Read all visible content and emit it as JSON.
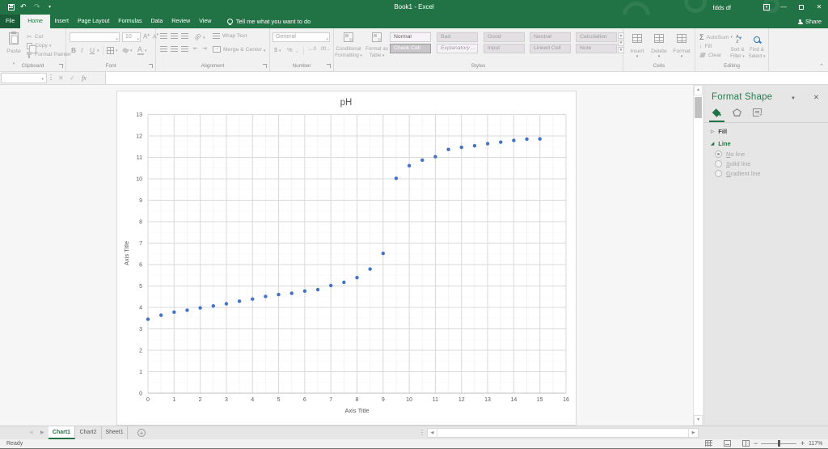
{
  "titlebar": {
    "title": "Book1 - Excel",
    "user": "fdds df"
  },
  "nav": {
    "file": "File",
    "tabs": [
      "Home",
      "Insert",
      "Page Layout",
      "Formulas",
      "Data",
      "Review",
      "View"
    ],
    "active_tab": "Home",
    "tell_me": "Tell me what you want to do",
    "share": "Share"
  },
  "ribbon": {
    "clipboard": {
      "label": "Clipboard",
      "paste": "Paste",
      "cut": "Cut",
      "copy": "Copy",
      "painter": "Format Painter"
    },
    "font": {
      "label": "Font",
      "size": "10",
      "bold": "B",
      "italic": "I",
      "underline": "U",
      "grow": "A",
      "shrink": "A",
      "color_letter": "A"
    },
    "alignment": {
      "label": "Alignment",
      "wrap": "Wrap Text",
      "merge": "Merge & Center"
    },
    "number": {
      "label": "Number",
      "format": "General",
      "currency": "$",
      "percent": "%",
      "comma": ",",
      "inc_dec": "←.0",
      "dec_dec": ".00→"
    },
    "styles": {
      "label": "Styles",
      "cf_line1": "Conditional",
      "cf_line2": "Formatting",
      "ft_line1": "Format as",
      "ft_line2": "Table",
      "row1": [
        "Normal",
        "Bad",
        "Good",
        "Neutral",
        "Calculation"
      ],
      "row2": [
        "Check Cell",
        "Explanatory ...",
        "Input",
        "Linked Cell",
        "Note"
      ]
    },
    "cells": {
      "label": "Cells",
      "insert": "Insert",
      "delete": "Delete",
      "format": "Format"
    },
    "editing": {
      "label": "Editing",
      "autosum": "AutoSum",
      "fill": "Fill",
      "clear": "Clear",
      "sort_line1": "Sort &",
      "sort_line2": "Filter",
      "find_line1": "Find &",
      "find_line2": "Select",
      "sort_icon_a": "A",
      "sort_icon_z": "Z"
    }
  },
  "formula_bar": {
    "name_box": "",
    "cancel": "✕",
    "enter": "✓",
    "fx": "fx",
    "value": ""
  },
  "pane": {
    "title": "Format Shape",
    "close": "✕",
    "fill_section": "Fill",
    "line_section": "Line",
    "options": [
      "No line",
      "Solid line",
      "Gradient line"
    ],
    "selected_option": "No line"
  },
  "sheet_tabs": {
    "tabs": [
      "Chart1",
      "Chart2",
      "Sheet1"
    ],
    "active": "Chart1",
    "add": "+"
  },
  "status_bar": {
    "ready": "Ready",
    "zoom": "117%"
  },
  "chart_data": {
    "type": "scatter",
    "title": "pH",
    "xlabel": "Axis Title",
    "ylabel": "Axis Title",
    "xlim": [
      0,
      16
    ],
    "ylim": [
      0,
      13
    ],
    "x_tick_step": 1,
    "y_tick_step": 1,
    "minor_grid_step": 0.5,
    "grid": true,
    "legend": false,
    "marker_color": "#4472c4",
    "x": [
      0,
      0.5,
      1,
      1.5,
      2,
      2.5,
      3,
      3.5,
      4,
      4.5,
      5,
      5.5,
      6,
      6.5,
      7,
      7.5,
      8,
      8.5,
      9,
      9.5,
      10,
      10.5,
      11,
      11.5,
      12,
      12.5,
      13,
      13.5,
      14,
      14.5,
      15
    ],
    "y": [
      3.45,
      3.64,
      3.78,
      3.87,
      3.98,
      4.07,
      4.17,
      4.29,
      4.39,
      4.51,
      4.6,
      4.66,
      4.76,
      4.83,
      5.02,
      5.17,
      5.39,
      5.79,
      6.52,
      10.02,
      10.61,
      10.87,
      11.03,
      11.37,
      11.47,
      11.54,
      11.64,
      11.71,
      11.79,
      11.85,
      11.86
    ]
  }
}
